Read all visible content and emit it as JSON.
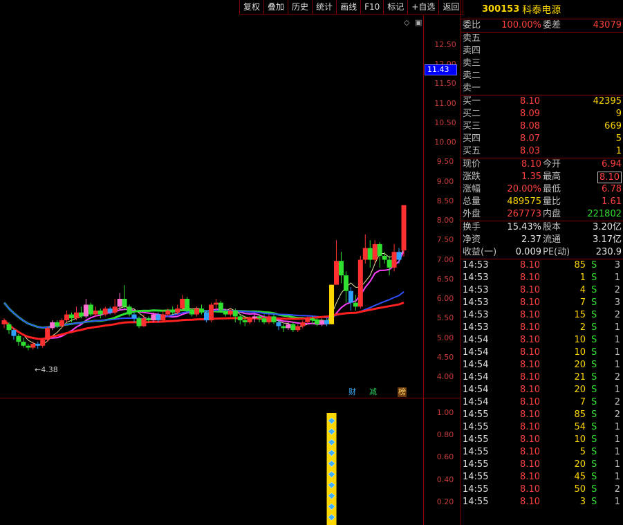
{
  "toolbar": {
    "buttons": [
      "复权",
      "叠加",
      "历史",
      "统计",
      "画线",
      "F10",
      "标记",
      "+自选",
      "返回"
    ]
  },
  "price_axis": {
    "labels": [
      "12.50",
      "12.00",
      "11.50",
      "11.00",
      "10.50",
      "10.00",
      "9.50",
      "9.00",
      "8.50",
      "8.00",
      "7.50",
      "7.00",
      "6.50",
      "6.00",
      "5.50",
      "5.00",
      "4.50",
      "4.00"
    ],
    "current_tag": "11.43"
  },
  "indicator_axis": {
    "labels": [
      "1.00",
      "0.80",
      "0.60",
      "0.40",
      "0.20"
    ]
  },
  "annotations": {
    "low_label": "←4.38",
    "tag_cai": "财",
    "tag_jian": "减",
    "tag_bang": "榜"
  },
  "header": {
    "code": "300153",
    "name": "科泰电源"
  },
  "ratio": {
    "label1": "委比",
    "value1": "100.00%",
    "label2": "委差",
    "value2": "43079"
  },
  "asks": [
    {
      "label": "卖五",
      "price": "",
      "volume": ""
    },
    {
      "label": "卖四",
      "price": "",
      "volume": ""
    },
    {
      "label": "卖三",
      "price": "",
      "volume": ""
    },
    {
      "label": "卖二",
      "price": "",
      "volume": ""
    },
    {
      "label": "卖一",
      "price": "",
      "volume": ""
    }
  ],
  "bids": [
    {
      "label": "买一",
      "price": "8.10",
      "volume": "42395"
    },
    {
      "label": "买二",
      "price": "8.09",
      "volume": "9"
    },
    {
      "label": "买三",
      "price": "8.08",
      "volume": "669"
    },
    {
      "label": "买四",
      "price": "8.07",
      "volume": "5"
    },
    {
      "label": "买五",
      "price": "8.03",
      "volume": "1"
    }
  ],
  "stats1": [
    {
      "l1": "现价",
      "v1": "8.10",
      "c1": "red",
      "l2": "今开",
      "v2": "6.94",
      "c2": "red"
    },
    {
      "l1": "涨跌",
      "v1": "1.35",
      "c1": "red",
      "l2": "最高",
      "v2": "8.10",
      "c2": "red"
    },
    {
      "l1": "涨幅",
      "v1": "20.00%",
      "c1": "red",
      "l2": "最低",
      "v2": "6.78",
      "c2": "red"
    },
    {
      "l1": "总量",
      "v1": "489575",
      "c1": "yellow",
      "l2": "量比",
      "v2": "1.61",
      "c2": "red"
    },
    {
      "l1": "外盘",
      "v1": "267773",
      "c1": "red",
      "l2": "内盘",
      "v2": "221802",
      "c2": "green"
    }
  ],
  "stats2": [
    {
      "l1": "换手",
      "v1": "15.43%",
      "c1": "white",
      "l2": "股本",
      "v2": "3.20亿",
      "c2": "white"
    },
    {
      "l1": "净资",
      "v1": "2.37",
      "c1": "white",
      "l2": "流通",
      "v2": "3.17亿",
      "c2": "white"
    },
    {
      "l1": "收益(一)",
      "v1": "0.009",
      "c1": "white",
      "l2": "PE(动)",
      "v2": "230.9",
      "c2": "white"
    }
  ],
  "ticks": [
    {
      "time": "14:53",
      "price": "8.10",
      "vol": "85",
      "flag": "S",
      "count": "3"
    },
    {
      "time": "14:53",
      "price": "8.10",
      "vol": "1",
      "flag": "S",
      "count": "1"
    },
    {
      "time": "14:53",
      "price": "8.10",
      "vol": "4",
      "flag": "S",
      "count": "2"
    },
    {
      "time": "14:53",
      "price": "8.10",
      "vol": "7",
      "flag": "S",
      "count": "3"
    },
    {
      "time": "14:53",
      "price": "8.10",
      "vol": "15",
      "flag": "S",
      "count": "2"
    },
    {
      "time": "14:53",
      "price": "8.10",
      "vol": "2",
      "flag": "S",
      "count": "1"
    },
    {
      "time": "14:54",
      "price": "8.10",
      "vol": "10",
      "flag": "S",
      "count": "1"
    },
    {
      "time": "14:54",
      "price": "8.10",
      "vol": "10",
      "flag": "S",
      "count": "1"
    },
    {
      "time": "14:54",
      "price": "8.10",
      "vol": "20",
      "flag": "S",
      "count": "1"
    },
    {
      "time": "14:54",
      "price": "8.10",
      "vol": "21",
      "flag": "S",
      "count": "2"
    },
    {
      "time": "14:54",
      "price": "8.10",
      "vol": "20",
      "flag": "S",
      "count": "1"
    },
    {
      "time": "14:54",
      "price": "8.10",
      "vol": "7",
      "flag": "S",
      "count": "2"
    },
    {
      "time": "14:55",
      "price": "8.10",
      "vol": "85",
      "flag": "S",
      "count": "2"
    },
    {
      "time": "14:55",
      "price": "8.10",
      "vol": "54",
      "flag": "S",
      "count": "1"
    },
    {
      "time": "14:55",
      "price": "8.10",
      "vol": "10",
      "flag": "S",
      "count": "1"
    },
    {
      "time": "14:55",
      "price": "8.10",
      "vol": "5",
      "flag": "S",
      "count": "1"
    },
    {
      "time": "14:55",
      "price": "8.10",
      "vol": "20",
      "flag": "S",
      "count": "1"
    },
    {
      "time": "14:55",
      "price": "8.10",
      "vol": "45",
      "flag": "S",
      "count": "1"
    },
    {
      "time": "14:55",
      "price": "8.10",
      "vol": "50",
      "flag": "S",
      "count": "2"
    },
    {
      "time": "14:55",
      "price": "8.10",
      "vol": "3",
      "flag": "S",
      "count": "1"
    }
  ],
  "chart_data": {
    "type": "candlestick",
    "y_range": [
      4.0,
      12.5
    ],
    "candles": [
      [
        5.05,
        5.15,
        4.95,
        5.2
      ],
      [
        5.05,
        4.9,
        4.8,
        5.1
      ],
      [
        4.9,
        4.75,
        4.65,
        4.95
      ],
      [
        4.75,
        4.6,
        4.5,
        4.8
      ],
      [
        4.6,
        4.5,
        4.45,
        4.7
      ],
      [
        4.5,
        4.45,
        4.38,
        4.55
      ],
      [
        4.45,
        4.55,
        4.4,
        4.6
      ],
      [
        4.55,
        4.5,
        4.42,
        4.6
      ],
      [
        4.5,
        4.65,
        4.45,
        4.7
      ],
      [
        4.65,
        4.95,
        4.6,
        5.0
      ],
      [
        4.95,
        5.1,
        4.9,
        5.15
      ],
      [
        5.1,
        5.0,
        4.95,
        5.15
      ],
      [
        5.0,
        5.15,
        4.95,
        5.2
      ],
      [
        5.15,
        5.3,
        5.1,
        5.4
      ],
      [
        5.3,
        5.2,
        5.1,
        5.35
      ],
      [
        5.2,
        5.35,
        5.15,
        5.5
      ],
      [
        5.35,
        5.25,
        5.2,
        5.5
      ],
      [
        5.25,
        5.55,
        5.2,
        5.7
      ],
      [
        5.55,
        5.3,
        5.25,
        5.6
      ],
      [
        5.3,
        5.4,
        5.25,
        5.5
      ],
      [
        5.4,
        5.3,
        5.2,
        5.45
      ],
      [
        5.3,
        5.45,
        5.25,
        5.5
      ],
      [
        5.45,
        5.35,
        5.3,
        5.5
      ],
      [
        5.35,
        5.5,
        5.3,
        5.7
      ],
      [
        5.5,
        5.7,
        5.4,
        5.85
      ],
      [
        5.7,
        5.5,
        5.45,
        6.05
      ],
      [
        5.5,
        5.3,
        5.25,
        5.55
      ],
      [
        5.3,
        5.2,
        5.1,
        5.35
      ],
      [
        5.2,
        5.0,
        4.95,
        5.25
      ],
      [
        5.0,
        5.2,
        4.98,
        5.3
      ],
      [
        5.2,
        5.15,
        5.1,
        5.25
      ],
      [
        5.15,
        5.3,
        5.1,
        5.35
      ],
      [
        5.3,
        5.15,
        5.1,
        5.35
      ],
      [
        5.15,
        5.3,
        5.1,
        5.4
      ],
      [
        5.3,
        5.4,
        5.25,
        5.45
      ],
      [
        5.4,
        5.35,
        5.3,
        5.5
      ],
      [
        5.35,
        5.45,
        5.3,
        5.55
      ],
      [
        5.45,
        5.7,
        5.4,
        5.8
      ],
      [
        5.7,
        5.4,
        5.35,
        5.75
      ],
      [
        5.4,
        5.3,
        5.25,
        5.45
      ],
      [
        5.3,
        5.45,
        5.25,
        5.5
      ],
      [
        5.45,
        5.35,
        5.3,
        5.55
      ],
      [
        5.35,
        5.15,
        5.1,
        5.4
      ],
      [
        5.15,
        5.55,
        5.1,
        5.6
      ],
      [
        5.55,
        5.6,
        5.4,
        5.7
      ],
      [
        5.6,
        5.4,
        5.35,
        5.65
      ],
      [
        5.4,
        5.3,
        5.25,
        5.45
      ],
      [
        5.3,
        5.4,
        5.25,
        5.45
      ],
      [
        5.4,
        5.25,
        5.1,
        5.45
      ],
      [
        5.25,
        5.15,
        5.05,
        5.3
      ],
      [
        5.15,
        5.1,
        5.0,
        5.25
      ],
      [
        5.1,
        5.2,
        5.05,
        5.25
      ],
      [
        5.2,
        5.25,
        5.1,
        5.3
      ],
      [
        5.25,
        5.2,
        5.1,
        5.3
      ],
      [
        5.2,
        5.1,
        5.05,
        5.3
      ],
      [
        5.1,
        5.25,
        5.05,
        5.3
      ],
      [
        5.25,
        5.1,
        5.05,
        5.3
      ],
      [
        5.1,
        5.0,
        4.9,
        5.15
      ],
      [
        5.0,
        4.95,
        4.85,
        5.05
      ],
      [
        4.95,
        5.05,
        4.9,
        5.1
      ],
      [
        5.05,
        4.9,
        4.85,
        5.1
      ],
      [
        4.9,
        5.0,
        4.85,
        5.05
      ],
      [
        5.0,
        5.1,
        4.95,
        5.15
      ],
      [
        5.1,
        5.2,
        5.05,
        5.25
      ],
      [
        5.2,
        5.15,
        5.05,
        5.25
      ],
      [
        5.15,
        5.05,
        5.0,
        5.2
      ],
      [
        5.05,
        5.15,
        5.0,
        5.2
      ],
      [
        5.15,
        5.05,
        5.0,
        5.2
      ],
      [
        5.05,
        6.06,
        5.05,
        6.06
      ],
      [
        6.06,
        6.67,
        6.5,
        7.2
      ],
      [
        6.67,
        6.3,
        6.1,
        6.9
      ],
      [
        6.3,
        5.9,
        5.6,
        6.4
      ],
      [
        5.9,
        5.6,
        5.4,
        6.0
      ],
      [
        5.6,
        5.5,
        5.4,
        5.8
      ],
      [
        5.5,
        6.7,
        5.45,
        6.8
      ],
      [
        6.7,
        7.0,
        6.6,
        7.35
      ],
      [
        7.0,
        6.7,
        6.5,
        7.2
      ],
      [
        6.7,
        7.1,
        6.6,
        7.2
      ],
      [
        7.1,
        6.8,
        6.5,
        7.15
      ],
      [
        6.8,
        6.7,
        6.6,
        6.9
      ],
      [
        6.7,
        6.5,
        6.3,
        6.8
      ],
      [
        6.5,
        6.9,
        6.4,
        7.1
      ],
      [
        6.9,
        6.7,
        6.6,
        7.0
      ],
      [
        6.94,
        8.1,
        6.78,
        8.1
      ]
    ]
  }
}
